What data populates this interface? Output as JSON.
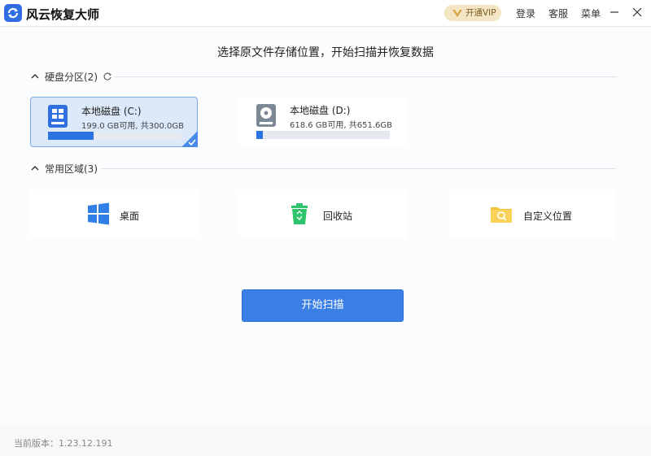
{
  "app": {
    "title": "风云恢复大师",
    "accent": "#2f6fe0"
  },
  "titlebar": {
    "vip_label": "开通VIP",
    "login_label": "登录",
    "service_label": "客服",
    "menu_label": "菜单",
    "minimize_icon": "minimize-icon",
    "close_icon": "close-icon"
  },
  "main": {
    "heading": "选择原文件存储位置，开始扫描并恢复数据",
    "disks_section": {
      "label": "硬盘分区(2)",
      "items": [
        {
          "name": "本地磁盘 (C:)",
          "size_text": "199.0 GB可用, 共300.0GB",
          "used_fraction": 0.34,
          "selected": true
        },
        {
          "name": "本地磁盘 (D:)",
          "size_text": "618.6 GB可用, 共651.6GB",
          "used_fraction": 0.05,
          "selected": false
        }
      ]
    },
    "areas_section": {
      "label": "常用区域(3)",
      "items": [
        {
          "label": "桌面",
          "icon": "windows-icon"
        },
        {
          "label": "回收站",
          "icon": "recycle-bin-icon"
        },
        {
          "label": "自定义位置",
          "icon": "folder-search-icon"
        }
      ]
    },
    "scan_button": "开始扫描"
  },
  "footer": {
    "version": "当前版本：1.23.12.191"
  }
}
